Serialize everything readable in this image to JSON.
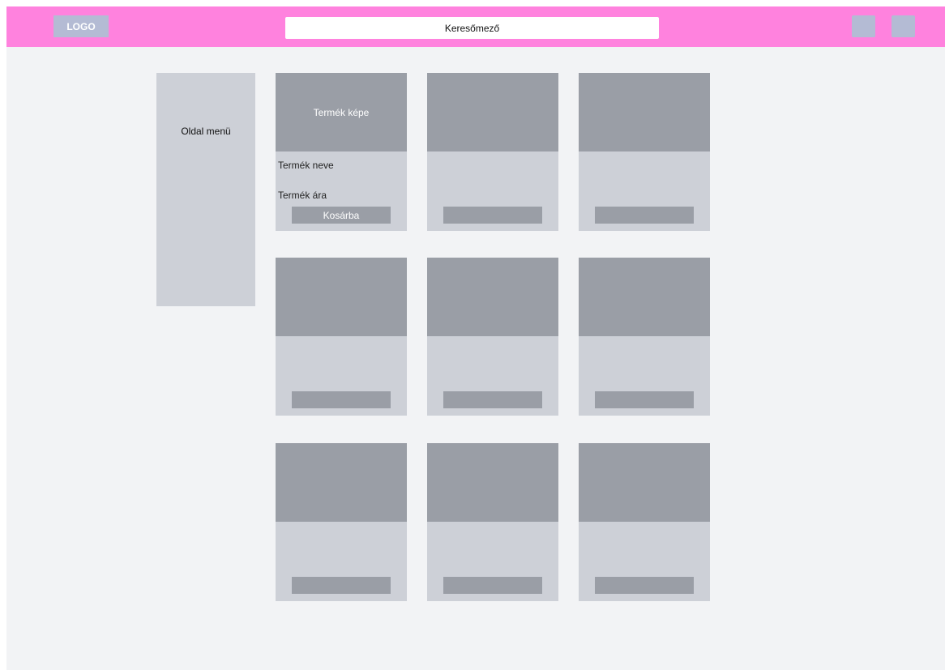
{
  "colors": {
    "header_bg": "#ff82de",
    "header_block": "#b4bbd4",
    "page_bg": "#f2f3f5",
    "panel": "#cdd0d7",
    "image_block": "#9a9ea6",
    "button_block": "#9a9ea6"
  },
  "header": {
    "logo_text": "LOGO",
    "search_placeholder": "Keresőmező"
  },
  "sidebar": {
    "label": "Oldal menü"
  },
  "products": [
    {
      "image_label": "Termék képe",
      "name": "Termék neve",
      "price": "Termék ára",
      "cart_label": "Kosárba"
    },
    {
      "image_label": "",
      "name": "",
      "price": "",
      "cart_label": ""
    },
    {
      "image_label": "",
      "name": "",
      "price": "",
      "cart_label": ""
    },
    {
      "image_label": "",
      "name": "",
      "price": "",
      "cart_label": ""
    },
    {
      "image_label": "",
      "name": "",
      "price": "",
      "cart_label": ""
    },
    {
      "image_label": "",
      "name": "",
      "price": "",
      "cart_label": ""
    },
    {
      "image_label": "",
      "name": "",
      "price": "",
      "cart_label": ""
    },
    {
      "image_label": "",
      "name": "",
      "price": "",
      "cart_label": ""
    },
    {
      "image_label": "",
      "name": "",
      "price": "",
      "cart_label": ""
    }
  ]
}
